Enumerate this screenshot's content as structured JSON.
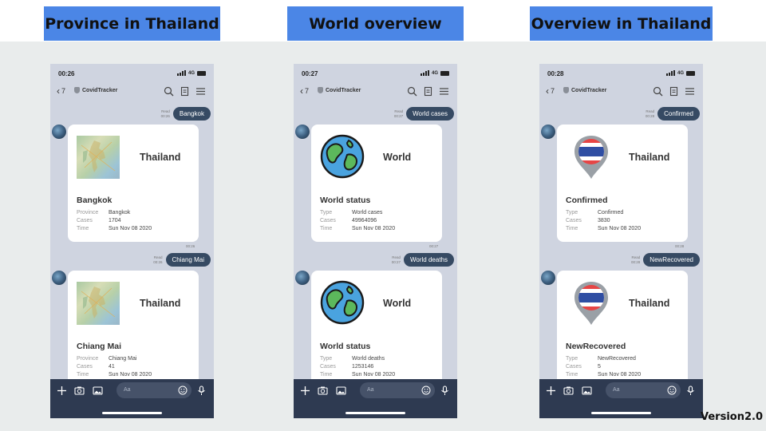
{
  "headers": [
    "Province in Thailand",
    "World overview",
    "Overview in Thailand"
  ],
  "version": "Version2.0",
  "phones": [
    {
      "status_time": "00:26",
      "network": "4G",
      "back_count": "7",
      "chat_title": "CovidTracker",
      "input_placeholder": "Aa",
      "messages": [
        {
          "query": "Bangkok",
          "read_label": "Read",
          "sent_time": "00:26",
          "reply_time": "00:26",
          "card": {
            "image": "map",
            "name": "Thailand",
            "title": "Bangkok",
            "rows": [
              {
                "k": "Province",
                "v": "Bangkok"
              },
              {
                "k": "Cases",
                "v": "1704"
              },
              {
                "k": "Time",
                "v": "Sun Nov 08 2020"
              }
            ]
          }
        },
        {
          "query": "Chiang Mai",
          "read_label": "Read",
          "sent_time": "00:26",
          "reply_time": "",
          "card": {
            "image": "map",
            "name": "Thailand",
            "title": "Chiang Mai",
            "rows": [
              {
                "k": "Province",
                "v": "Chiang Mai"
              },
              {
                "k": "Cases",
                "v": "41"
              },
              {
                "k": "Time",
                "v": "Sun Nov 08 2020"
              }
            ]
          }
        }
      ]
    },
    {
      "status_time": "00:27",
      "network": "4G",
      "back_count": "7",
      "chat_title": "CovidTracker",
      "input_placeholder": "Aa",
      "messages": [
        {
          "query": "World cases",
          "read_label": "Read",
          "sent_time": "00:27",
          "reply_time": "00:27",
          "card": {
            "image": "globe",
            "name": "World",
            "title": "World status",
            "rows": [
              {
                "k": "Type",
                "v": "World cases"
              },
              {
                "k": "Cases",
                "v": "49964096"
              },
              {
                "k": "Time",
                "v": "Sun Nov 08 2020"
              }
            ]
          }
        },
        {
          "query": "World deaths",
          "read_label": "Read",
          "sent_time": "00:27",
          "reply_time": "",
          "card": {
            "image": "globe",
            "name": "World",
            "title": "World status",
            "rows": [
              {
                "k": "Type",
                "v": "World deaths"
              },
              {
                "k": "Cases",
                "v": "1253146"
              },
              {
                "k": "Time",
                "v": "Sun Nov 08 2020"
              }
            ]
          }
        }
      ]
    },
    {
      "status_time": "00:28",
      "network": "4G",
      "back_count": "7",
      "chat_title": "CovidTracker",
      "input_placeholder": "Aa",
      "messages": [
        {
          "query": "Confirmed",
          "read_label": "Read",
          "sent_time": "00:28",
          "reply_time": "00:28",
          "card": {
            "image": "flag-pin",
            "name": "Thailand",
            "title": "Confirmed",
            "rows": [
              {
                "k": "Type",
                "v": "Confirmed"
              },
              {
                "k": "Cases",
                "v": "3830"
              },
              {
                "k": "Time",
                "v": "Sun Nov 08 2020"
              }
            ]
          }
        },
        {
          "query": "NewRecovered",
          "read_label": "Read",
          "sent_time": "00:28",
          "reply_time": "",
          "card": {
            "image": "flag-pin",
            "name": "Thailand",
            "title": "NewRecovered",
            "rows": [
              {
                "k": "Type",
                "v": "NewRecovered"
              },
              {
                "k": "Cases",
                "v": "5"
              },
              {
                "k": "Time",
                "v": "Sun Nov 08 2020"
              }
            ]
          }
        }
      ]
    }
  ]
}
